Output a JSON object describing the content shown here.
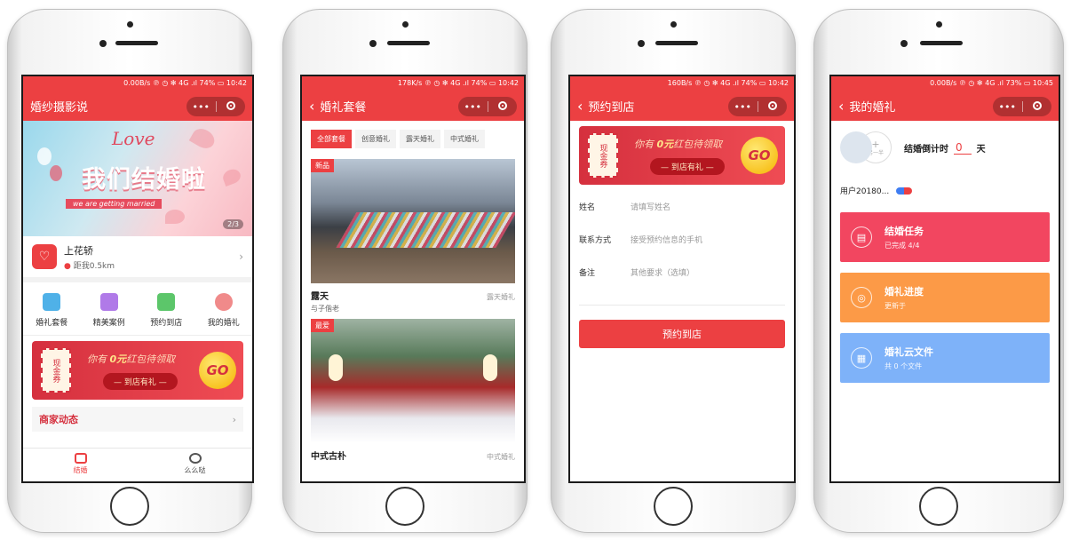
{
  "colors": {
    "brand": "#ec4042",
    "task1": "#f24660",
    "task2": "#fc9a47",
    "task3": "#7eb2f9"
  },
  "screen1": {
    "status": "0.00B/s ℗ ◷ ✻ 4G .ıl 74% ▭ 10:42",
    "nav_title": "婚纱摄影说",
    "capsule_more": "•••",
    "banner": {
      "love": "Love",
      "headline": "我们结婚啦",
      "tagline": "we are getting married",
      "pager": "2/3"
    },
    "shop": {
      "name": "上花轿",
      "distance": "距我0.5km"
    },
    "grid": [
      "婚礼套餐",
      "精美案例",
      "预约到店",
      "我的婚礼"
    ],
    "coupon": {
      "ticket": "现金券",
      "msg_pre": "你有 ",
      "msg_amount": "0元",
      "msg_post": "红包待领取",
      "pill": "— 到店有礼 —",
      "go": "GO"
    },
    "news": {
      "label": "商家动态",
      "arrow": "›"
    },
    "tabs": [
      "结婚",
      "么么哒"
    ]
  },
  "screen2": {
    "status": "178K/s ℗ ◷ ✻ 4G .ıl 74% ▭ 10:42",
    "nav_title": "婚礼套餐",
    "filters": [
      "全部套餐",
      "创意婚礼",
      "露天婚礼",
      "中式婚礼"
    ],
    "cards": [
      {
        "tag": "新品",
        "title": "露天",
        "category": "露天婚礼",
        "desc": "与子偕老"
      },
      {
        "tag": "最爱",
        "title": "中式古朴",
        "category": "中式婚礼",
        "desc": ""
      }
    ]
  },
  "screen3": {
    "status": "160B/s ℗ ◷ ✻ 4G .ıl 74% ▭ 10:42",
    "nav_title": "预约到店",
    "coupon": {
      "ticket": "现金券",
      "msg_pre": "你有 ",
      "msg_amount": "0元",
      "msg_post": "红包待领取",
      "pill": "— 到店有礼 —",
      "go": "GO"
    },
    "form": [
      {
        "label": "姓名",
        "placeholder": "请填写姓名"
      },
      {
        "label": "联系方式",
        "placeholder": "接受预约信息的手机"
      },
      {
        "label": "备注",
        "placeholder": "其他要求（选填）"
      }
    ],
    "submit": "预约到店"
  },
  "screen4": {
    "status": "0.00B/s ℗ ◷ ✻ 4G .ıl 73% ▭ 10:45",
    "nav_title": "我的婚礼",
    "add_partner": "另一半",
    "countdown_label": "结婚倒计时",
    "countdown_value": "0",
    "countdown_unit": "天",
    "user": "用户20180...",
    "tasks": [
      {
        "title": "结婚任务",
        "sub": "已完成 4/4",
        "icon": "checklist-icon"
      },
      {
        "title": "婚礼进度",
        "sub": "更新于",
        "icon": "progress-icon"
      },
      {
        "title": "婚礼云文件",
        "sub": "共 0 个文件",
        "icon": "file-icon"
      }
    ]
  }
}
